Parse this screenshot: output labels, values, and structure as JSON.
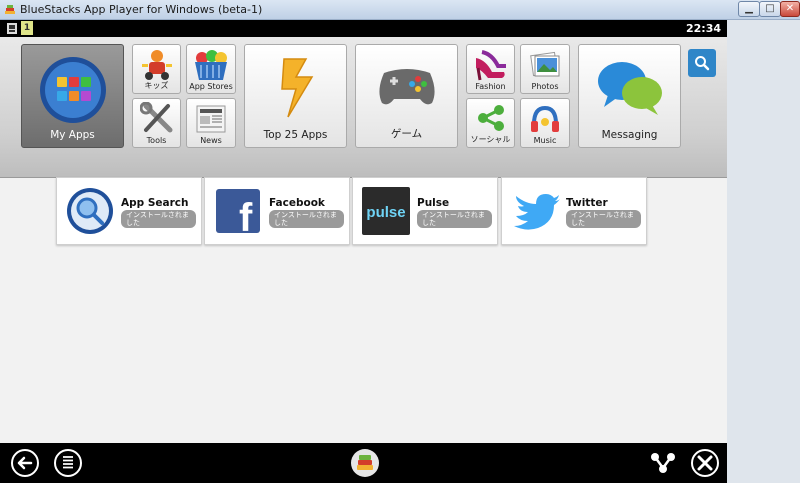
{
  "window": {
    "title": "BlueStacks App Player for Windows (beta-1)",
    "minimize_glyph": "▁",
    "maximize_glyph": "□",
    "close_glyph": "✕"
  },
  "statusbar": {
    "time": "22:34",
    "notification_count": "1"
  },
  "categories": {
    "my_apps": "My Apps",
    "kids": "キッズ",
    "app_stores": "App Stores",
    "tools": "Tools",
    "news": "News",
    "top25": "Top 25 Apps",
    "games": "ゲーム",
    "fashion": "Fashion",
    "photos": "Photos",
    "social": "ソーシャル",
    "music": "Music",
    "messaging": "Messaging"
  },
  "apps": [
    {
      "name": "App Search",
      "status": "インストールされました"
    },
    {
      "name": "Facebook",
      "status": "インストールされました"
    },
    {
      "name": "Pulse",
      "status": "インストールされました"
    },
    {
      "name": "Twitter",
      "status": "インストールされました"
    }
  ],
  "icons": {
    "pulse_logo_text": "pulse",
    "facebook_glyph": "f"
  },
  "colors": {
    "accent": "#2f86c8",
    "status_badge": "#9a9a9a"
  }
}
